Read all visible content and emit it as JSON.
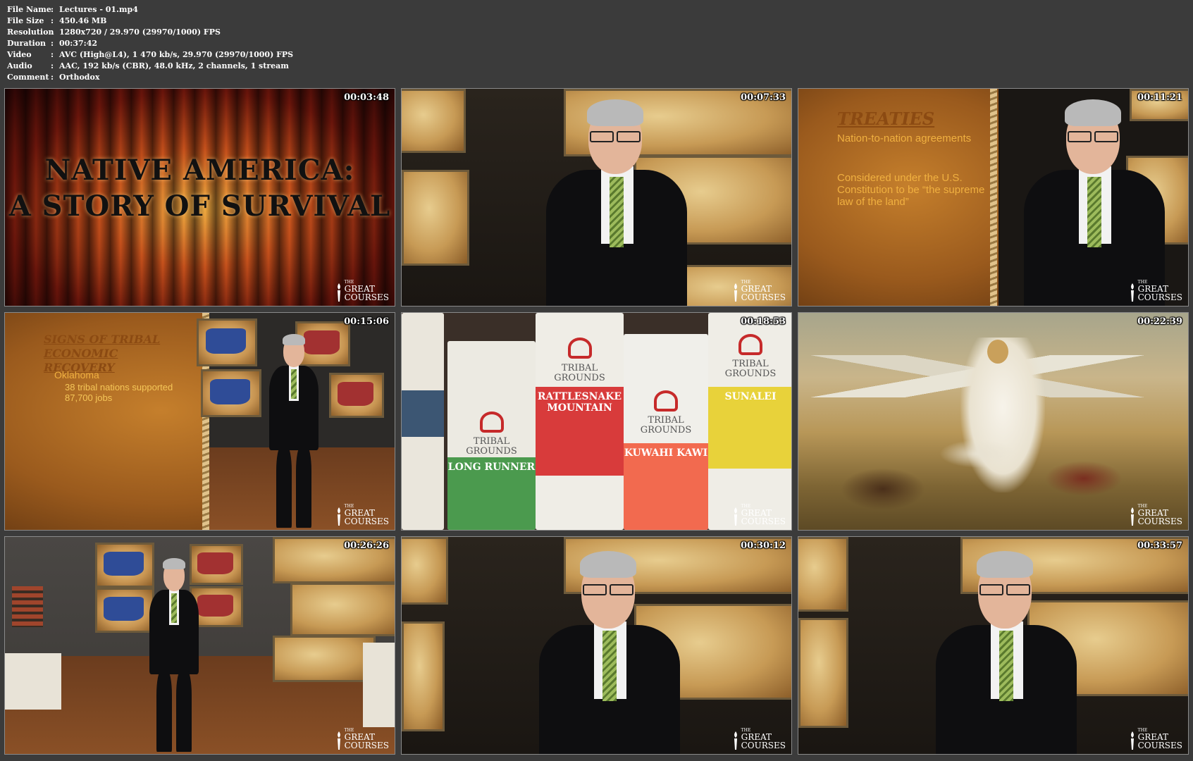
{
  "meta": [
    {
      "label": "File Name",
      "value": "Lectures - 01.mp4"
    },
    {
      "label": "File Size",
      "value": "450.46 MB"
    },
    {
      "label": "Resolution",
      "value": "1280x720 / 29.970 (29970/1000) FPS"
    },
    {
      "label": "Duration",
      "value": "00:37:42"
    },
    {
      "label": "Video",
      "value": "AVC (High@L4), 1 470 kb/s, 29.970 (29970/1000) FPS"
    },
    {
      "label": "Audio",
      "value": "AAC, 192 kb/s (CBR), 48.0 kHz, 2 channels, 1 stream"
    },
    {
      "label": "Comment",
      "value": "Orthodox"
    }
  ],
  "separator": ":",
  "logo": {
    "the": "THE",
    "line1": "GREAT",
    "line2": "COURSES"
  },
  "thumbs": [
    {
      "time": "00:03:48",
      "title_line1": "NATIVE AMERICA:",
      "title_line2": "A STORY OF SURVIVAL"
    },
    {
      "time": "00:07:33"
    },
    {
      "time": "00:11:21",
      "slide_title": "TREATIES",
      "bullet1": "Nation-to-nation agreements",
      "bullet2": "Considered under the U.S. Constitution to be “the supreme law of the land”"
    },
    {
      "time": "00:15:06",
      "slide_title": "SIGNS OF TRIBAL ECONOMIC RECOVERY",
      "bullet1": "Oklahoma",
      "sub1": "38 tribal nations supported 87,700 jobs"
    },
    {
      "time": "00:18:53",
      "bags": [
        {
          "brand": "TRIBAL GROUNDS",
          "band": "LONG RUNNER"
        },
        {
          "brand": "TRIBAL GROUNDS",
          "band": "RATTLESNAKE MOUNTAIN"
        },
        {
          "brand": "TRIBAL GROUNDS",
          "band": "KUWAHI KAWI"
        },
        {
          "brand": "TRIBAL GROUNDS",
          "band": "SUNALEI"
        }
      ]
    },
    {
      "time": "00:22:39"
    },
    {
      "time": "00:26:26"
    },
    {
      "time": "00:30:12"
    },
    {
      "time": "00:33:57"
    }
  ],
  "colors": {
    "background": "#3b3b3b",
    "text": "#ffffff",
    "border": "#8a8a8a"
  }
}
